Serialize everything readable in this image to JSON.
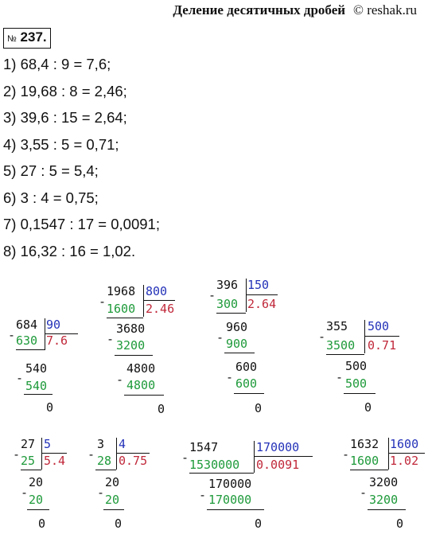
{
  "header": {
    "title": "Деление десятичных дробей",
    "site": "© reshak.ru"
  },
  "task": {
    "no_sign": "№",
    "number": "237."
  },
  "equations": [
    "1) 68,4 : 9 = 7,6;",
    "2) 19,68 : 8 = 2,46;",
    "3) 39,6 : 15 = 2,64;",
    "4) 3,55 : 5 = 0,71;",
    "5) 27 : 5 = 5,4;",
    "6) 3 : 4 = 0,75;",
    "7) 0,1547 : 17 = 0,0091;",
    "8) 16,32 : 16 = 1,02."
  ],
  "divisions": {
    "d1": {
      "dividend": "684",
      "divisor": "90",
      "sub1": "630",
      "quotient": "7.6",
      "r1": "540",
      "sub2": "540",
      "rem": "0"
    },
    "d2": {
      "dividend": "1968",
      "divisor": "800",
      "sub1": "1600",
      "quotient": "2.46",
      "r1": "3680",
      "sub2": "3200",
      "r2": "4800",
      "sub3": "4800",
      "rem": "0"
    },
    "d3": {
      "dividend": "396",
      "divisor": "150",
      "sub1": "300",
      "quotient": "2.64",
      "r1": "960",
      "sub2": "900",
      "r2": "600",
      "sub3": "600",
      "rem": "0"
    },
    "d4": {
      "dividend": "355",
      "divisor": "500",
      "sub1": "3500",
      "quotient": "0.71",
      "r1": "500",
      "sub2": "500",
      "rem": "0"
    },
    "d5": {
      "dividend": "27",
      "divisor": "5",
      "sub1": "25",
      "quotient": "5.4",
      "r1": "20",
      "sub2": "20",
      "rem": "0"
    },
    "d6": {
      "dividend": "3",
      "divisor": "4",
      "sub1": "28",
      "quotient": "0.75",
      "r1": "20",
      "sub2": "20",
      "rem": "0"
    },
    "d7": {
      "dividend": "1547",
      "divisor": "170000",
      "sub1": "1530000",
      "quotient": "0.0091",
      "r1": "170000",
      "sub2": "170000",
      "rem": "0"
    },
    "d8": {
      "dividend": "1632",
      "divisor": "1600",
      "sub1": "1600",
      "quotient": "1.02",
      "r1": "3200",
      "sub2": "3200",
      "rem": "0"
    }
  },
  "minus_sign": "-",
  "colors": {
    "green": "#1e9a3a",
    "blue": "#2432b8",
    "red": "#c0283a"
  }
}
